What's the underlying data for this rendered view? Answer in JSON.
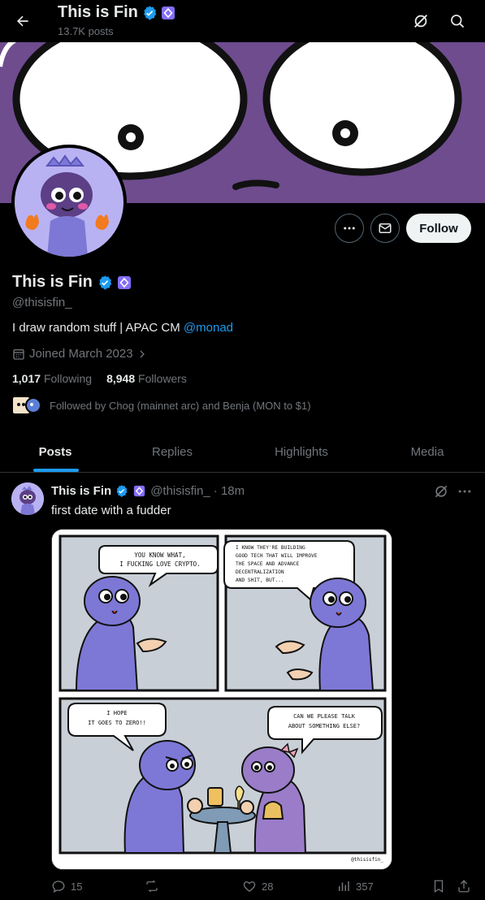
{
  "header": {
    "title": "This is Fin",
    "posts_count": "13.7K posts"
  },
  "profile": {
    "name": "This is Fin",
    "handle": "@thisisfin_",
    "bio_text": "I draw random stuff | APAC CM ",
    "bio_mention": "@monad",
    "joined": "Joined March 2023",
    "following_count": "1,017",
    "following_label": "Following",
    "followers_count": "8,948",
    "followers_label": "Followers",
    "followed_by": "Followed by Chog (mainnet arc) and Benja (MON to $1)",
    "follow_label": "Follow"
  },
  "tabs": [
    {
      "label": "Posts"
    },
    {
      "label": "Replies"
    },
    {
      "label": "Highlights"
    },
    {
      "label": "Media"
    }
  ],
  "post": {
    "name": "This is Fin",
    "handle": "@thisisfin_",
    "time": "· 18m",
    "text": "first date with a fudder",
    "comic": {
      "panel1": "YOU KNOW WHAT, I FUCKING LOVE CRYPTO.",
      "panel2": "I KNOW THEY'RE BUILDING GOOD TECH THAT WILL IMPROVE THE SPACE AND ADVANCE DECENTRALIZATION AND SHIT, BUT...",
      "panel3_left": "I HOPE IT GOES TO ZERO!!",
      "panel3_right": "CAN WE PLEASE TALK ABOUT SOMETHING ELSE?",
      "signature": "@thisisfin_"
    },
    "replies": "15",
    "reposts": "",
    "likes": "28",
    "views": "357"
  },
  "colors": {
    "accent": "#1d9bf0",
    "banner": "#6e4c8e",
    "character": "#7d78d6"
  }
}
